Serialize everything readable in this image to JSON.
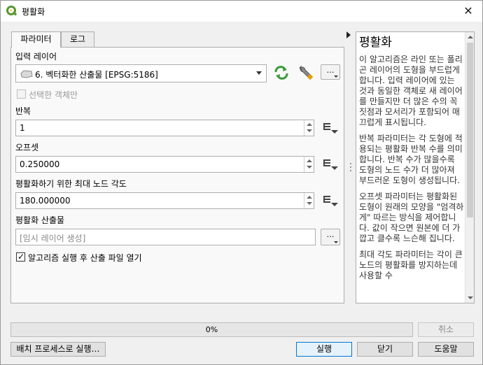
{
  "window": {
    "title": "평활화",
    "close_glyph": "✕"
  },
  "tabs": [
    {
      "label": "파라미터"
    },
    {
      "label": "로그"
    }
  ],
  "params": {
    "input_layer": {
      "label": "입력 레이어",
      "value": "6. 벡터화한 산출물 [EPSG:5186]",
      "more_glyph": "…"
    },
    "selected_only": {
      "label": "선택한 객체만",
      "checked": false,
      "enabled": false
    },
    "iterations": {
      "label": "반복",
      "value": "1"
    },
    "offset": {
      "label": "오프셋",
      "value": "0.250000"
    },
    "max_angle": {
      "label": "평활화하기 위한 최대 노드 각도",
      "value": "180.000000"
    },
    "output": {
      "label": "평활화 산출물",
      "placeholder": "[임시 레이어 생성]",
      "more_glyph": "…"
    },
    "open_output": {
      "label": "알고리즘 실행 후 산출 파일 열기",
      "checked": true,
      "check_glyph": "✓"
    }
  },
  "help": {
    "title": "평활화",
    "paragraphs": [
      "이 알고리즘은 라인 또는 폴리곤 레이어의 도형을 부드럽게 합니다. 입력 레이어에 있는 것과 동일한 객체로 새 레이어를 만들지만 더 많은 수의 꼭짓점과 모서리가 포함되어 매끄럽게 표시됩니다.",
      "반복 파라미터는 각 도형에 적용되는 평활화 반복 수를 의미합니다. 반복 수가 많을수록 도형의 노드 수가 더 많아져 부드러운 도형이 생성됩니다.",
      "오프셋 파라미터는 평활화된 도형이 원래의 모양을 \"엄격하게\" 따르는 방식을 제어합니다. 값이 작으면 원본에 더 가깝고 클수록 느슨해 집니다.",
      "최대 각도 파라미터는 각이 큰 노드의 평활화를 방지하는데 사용할 수"
    ]
  },
  "footer": {
    "progress_text": "0%",
    "progress_value": 0,
    "cancel_label": "취소",
    "batch_label": "배치 프로세스로 실행…",
    "run_label": "실행",
    "close_label": "닫기",
    "help_label": "도움말"
  },
  "colors": {
    "qgis_green": "#589632",
    "qgis_yellow": "#ffd940",
    "sync_green": "#3c9b3c",
    "default_border": "#0078d7"
  }
}
